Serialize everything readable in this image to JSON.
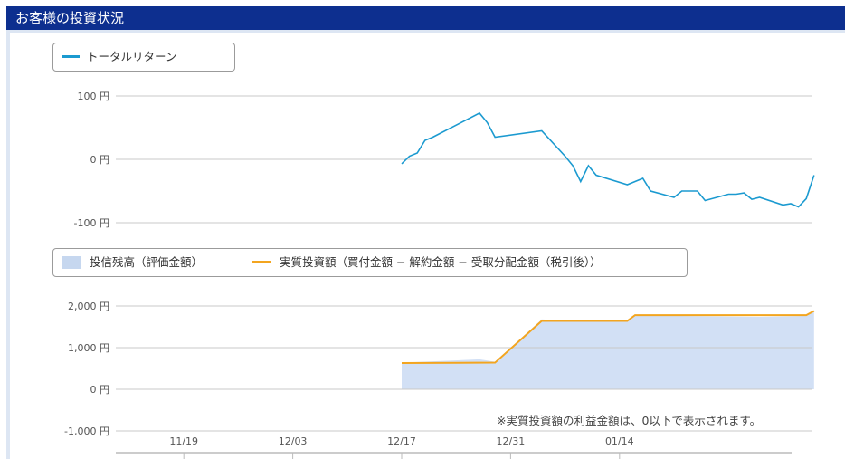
{
  "header": {
    "title": "お客様の投資状況"
  },
  "note": "※実質投資額の利益金額は、0以下で表示されます。",
  "colors": {
    "header_bg": "#0d2f8f",
    "return_line": "#1b9ad0",
    "invest_line": "#f3a51f",
    "balance_fill": "#d2e0f5",
    "grid": "#c8c8c8"
  },
  "chart_data": [
    {
      "type": "line",
      "legend": [
        "トータルリターン"
      ],
      "y_ticks": [
        "100 円",
        "0 円",
        "-100 円"
      ],
      "ylim": [
        -100,
        100
      ],
      "series": [
        {
          "name": "トータルリターン",
          "points": [
            [
              "2018-12-17",
              -7
            ],
            [
              "2018-12-18",
              5
            ],
            [
              "2018-12-19",
              10
            ],
            [
              "2018-12-20",
              30
            ],
            [
              "2018-12-21",
              35
            ],
            [
              "2018-12-27",
              73
            ],
            [
              "2018-12-28",
              58
            ],
            [
              "2018-12-29",
              35
            ],
            [
              "2019-01-04",
              45
            ],
            [
              "2019-01-07",
              5
            ],
            [
              "2019-01-08",
              -10
            ],
            [
              "2019-01-09",
              -35
            ],
            [
              "2019-01-10",
              -10
            ],
            [
              "2019-01-11",
              -25
            ],
            [
              "2019-01-15",
              -40
            ],
            [
              "2019-01-16",
              -35
            ],
            [
              "2019-01-17",
              -30
            ],
            [
              "2019-01-18",
              -50
            ],
            [
              "2019-01-21",
              -60
            ],
            [
              "2019-01-22",
              -50
            ],
            [
              "2019-01-24",
              -50
            ],
            [
              "2019-01-25",
              -65
            ],
            [
              "2019-01-28",
              -55
            ],
            [
              "2019-01-29",
              -55
            ],
            [
              "2019-01-30",
              -53
            ],
            [
              "2019-01-31",
              -63
            ],
            [
              "2019-02-01",
              -60
            ],
            [
              "2019-02-04",
              -72
            ],
            [
              "2019-02-05",
              -70
            ],
            [
              "2019-02-06",
              -75
            ],
            [
              "2019-02-07",
              -62
            ],
            [
              "2019-02-08",
              -25
            ]
          ]
        }
      ]
    },
    {
      "type": "area",
      "legend": [
        "投信残高（評価金額）",
        "実質投資額（買付金額 − 解約金額 − 受取分配金額（税引後））"
      ],
      "y_ticks": [
        "2,000 円",
        "1,000 円",
        "0 円",
        "-1,000 円"
      ],
      "x_ticks": [
        "11/19",
        "12/03",
        "12/17",
        "12/31",
        "01/14"
      ],
      "ylim": [
        -1000,
        2000
      ],
      "series": [
        {
          "name": "投信残高（評価金額）",
          "points": [
            [
              "2018-12-17",
              640
            ],
            [
              "2018-12-21",
              670
            ],
            [
              "2018-12-27",
              720
            ],
            [
              "2018-12-29",
              660
            ],
            [
              "2019-01-04",
              1680
            ],
            [
              "2019-01-07",
              1640
            ],
            [
              "2019-01-10",
              1650
            ],
            [
              "2019-01-15",
              1640
            ],
            [
              "2019-01-16",
              1770
            ],
            [
              "2019-01-18",
              1770
            ],
            [
              "2019-02-01",
              1740
            ],
            [
              "2019-02-07",
              1760
            ],
            [
              "2019-02-08",
              1860
            ]
          ]
        },
        {
          "name": "実質投資額（買付金額 − 解約金額 − 受取分配金額（税引後））",
          "points": [
            [
              "2018-12-17",
              630
            ],
            [
              "2018-12-29",
              640
            ],
            [
              "2019-01-04",
              1640
            ],
            [
              "2019-01-15",
              1640
            ],
            [
              "2019-01-16",
              1780
            ],
            [
              "2019-02-07",
              1780
            ],
            [
              "2019-02-08",
              1880
            ]
          ]
        }
      ]
    }
  ]
}
